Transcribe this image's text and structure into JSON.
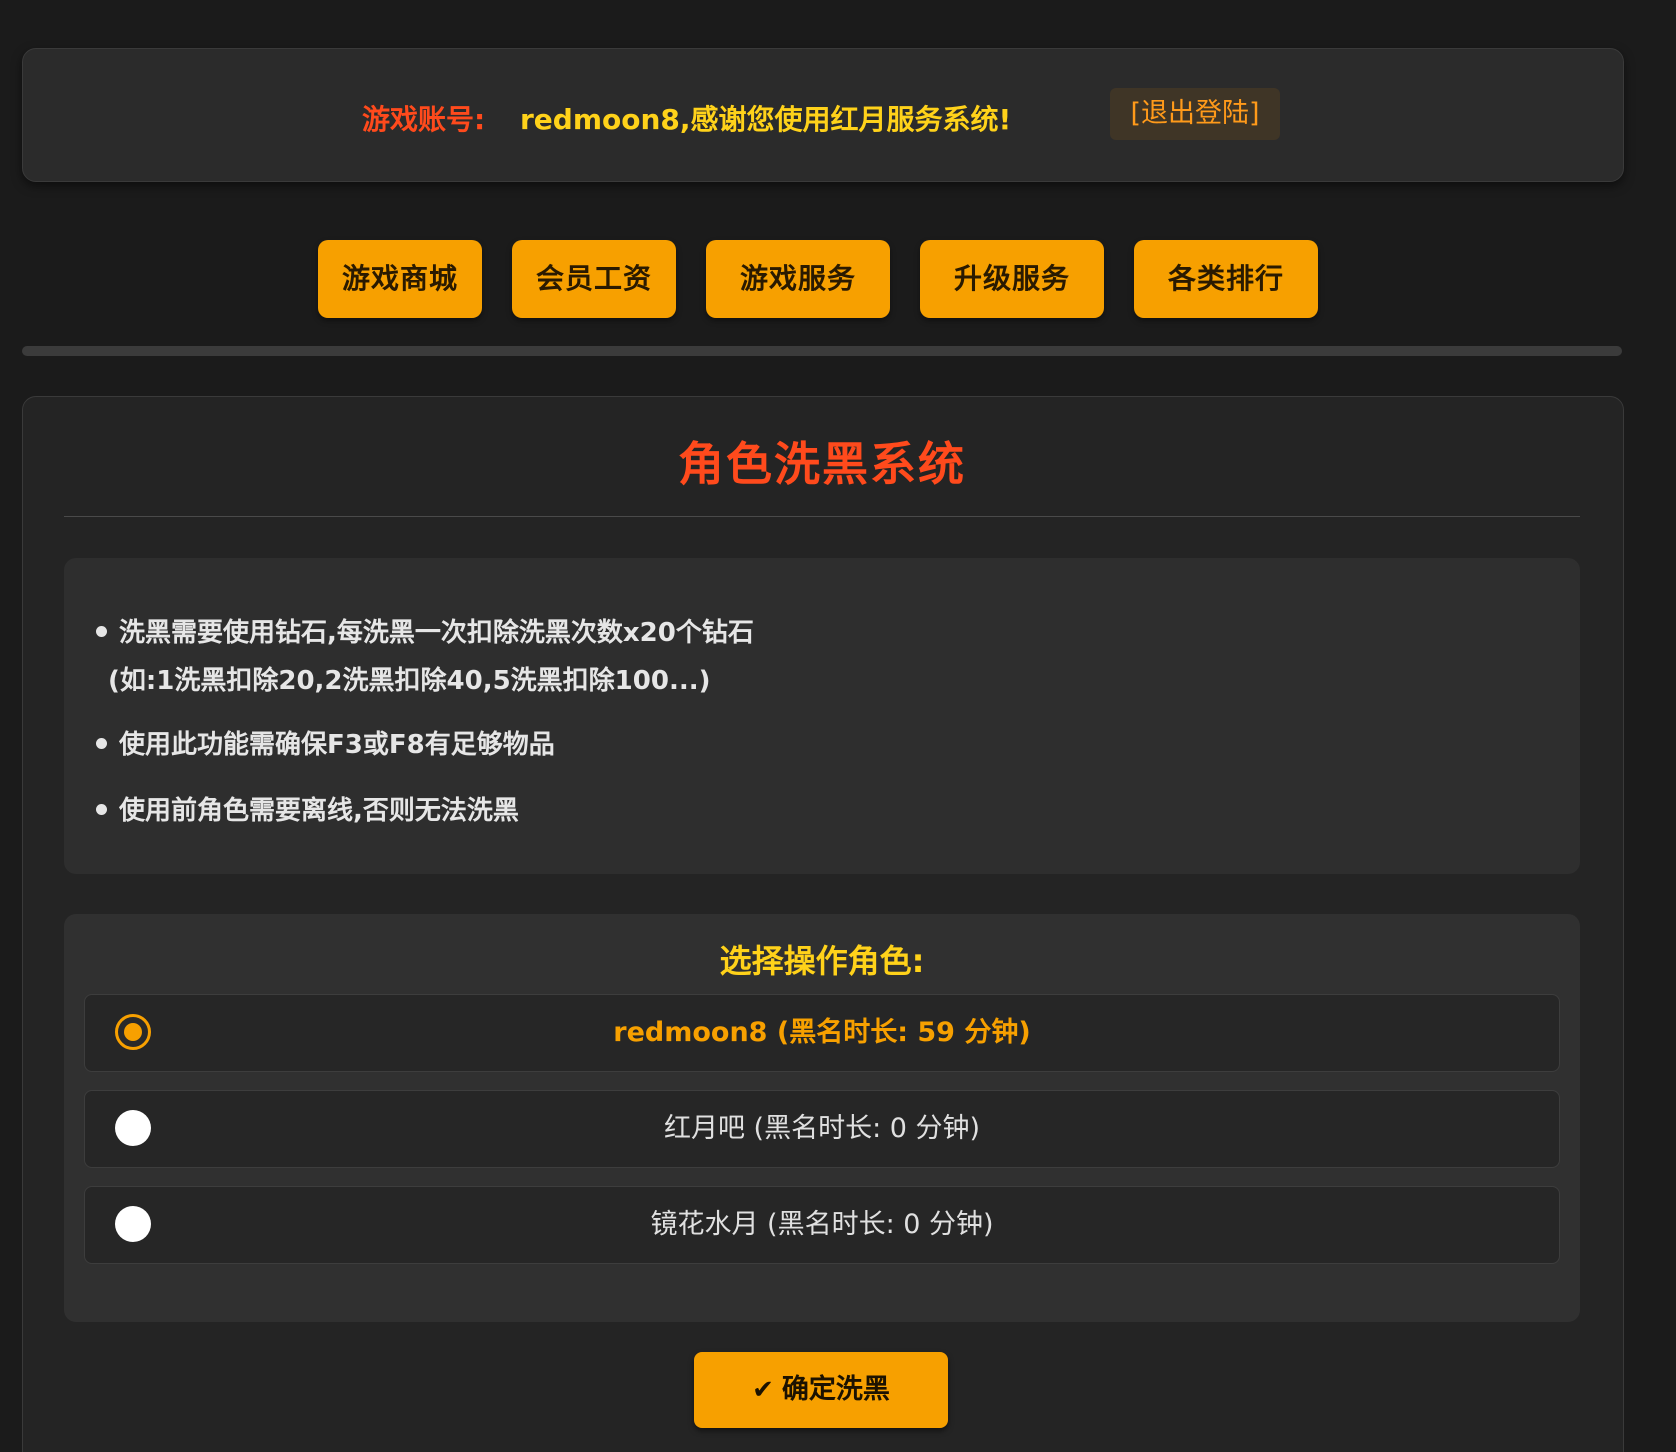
{
  "header": {
    "account_label": "游戏账号:",
    "welcome_text": "redmoon8,感谢您使用红月服务系统!",
    "logout_label": "[退出登陆]"
  },
  "nav": {
    "items": [
      {
        "label": "游戏商城"
      },
      {
        "label": "会员工资"
      },
      {
        "label": "游戏服务"
      },
      {
        "label": "升级服务"
      },
      {
        "label": "各类排行"
      }
    ]
  },
  "main": {
    "title": "角色洗黑系统",
    "info": [
      "洗黑需要使用钻石,每洗黑一次扣除洗黑次数x20个钻石",
      "(如:1洗黑扣除20,2洗黑扣除40,5洗黑扣除100...)",
      "使用此功能需确保F3或F8有足够物品",
      "使用前角色需要离线,否则无法洗黑"
    ],
    "role_heading": "选择操作角色:",
    "roles": [
      {
        "text": "redmoon8 (黑名时长: 59 分钟)",
        "selected": true
      },
      {
        "text": "红月吧 (黑名时长: 0 分钟)",
        "selected": false
      },
      {
        "text": "镜花水月 (黑名时长: 0 分钟)",
        "selected": false
      }
    ],
    "confirm_label": "确定洗黑",
    "confirm_icon": "✔"
  },
  "colors": {
    "accent": "#f7a000",
    "title_red": "#ff4a1c",
    "highlight_yellow": "#ffd21a",
    "background": "#1b1b1b"
  }
}
